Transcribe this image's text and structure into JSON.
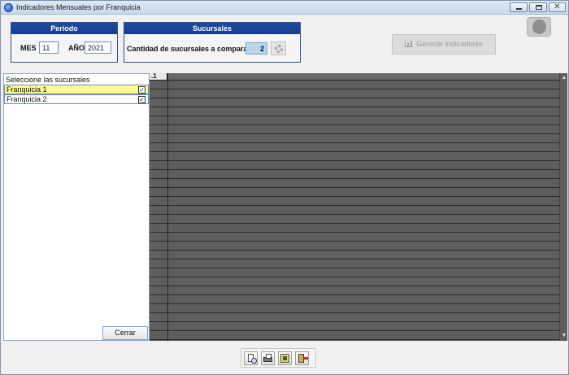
{
  "window": {
    "title": "Indicadores Mensuales por Franquicia",
    "close_glyph": "✕"
  },
  "periodo": {
    "header": "Período",
    "mes_label": "MES",
    "mes_value": "11",
    "anio_label": "AÑO",
    "anio_value": "2021"
  },
  "sucursales": {
    "header": "Sucursales",
    "cantidad_label": "Cantidad de sucursales a comparar",
    "cantidad_value": "2",
    "gear_icon": "gear-icon"
  },
  "toolbar": {
    "generar_label": "Generar indicadores",
    "generar_icon": "bar-chart-icon",
    "avatar_icon": "user-avatar-icon"
  },
  "list": {
    "caption": "Seleccione las sucursales",
    "items": [
      {
        "label": "Franquicia 1",
        "checked": true,
        "selected": true
      },
      {
        "label": "Franquicia 2",
        "checked": true,
        "selected": false
      }
    ],
    "check_glyph": "✓",
    "close_label": "Cerrar"
  },
  "grid": {
    "header_label": ".1",
    "scroll_up": "▲",
    "scroll_down": "▼"
  },
  "bottom_tools": [
    {
      "name": "print-preview-icon"
    },
    {
      "name": "print-icon"
    },
    {
      "name": "export-excel-icon"
    },
    {
      "name": "exit-icon"
    }
  ],
  "colors": {
    "group_header": "#1f4aa3",
    "selected_row": "#fffb8c",
    "count_box": "#b8d7ee",
    "grid_bg": "#5e5e5e"
  }
}
